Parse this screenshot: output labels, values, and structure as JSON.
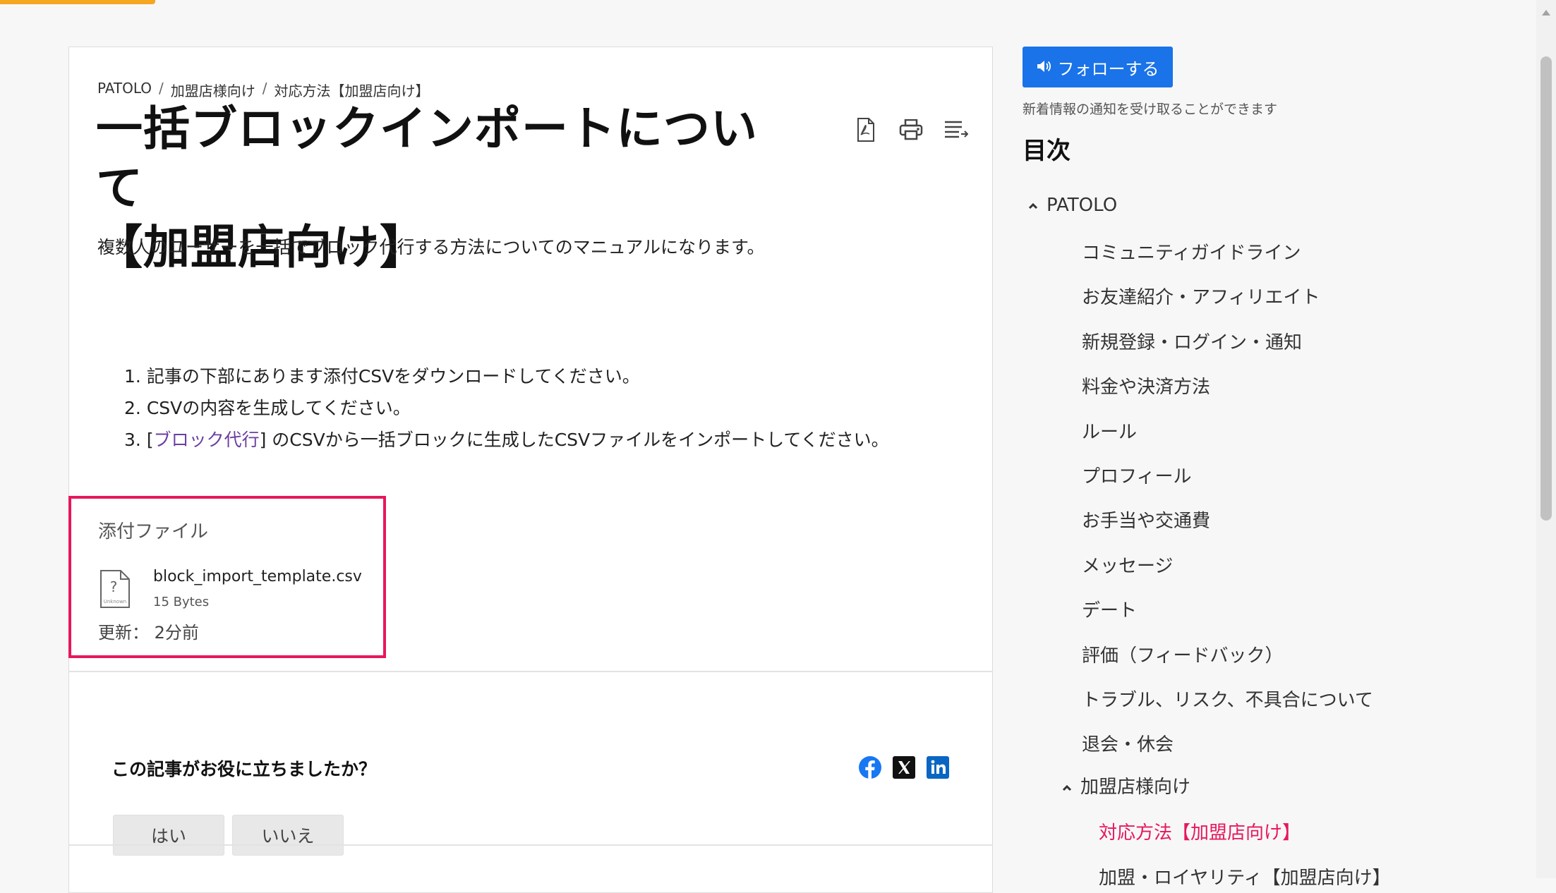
{
  "breadcrumb": [
    "PATOLO",
    "加盟店様向け",
    "対応方法【加盟店向け】"
  ],
  "breadcrumb_sep": "/",
  "article": {
    "title_line1": "一括ブロックインポートについて",
    "title_line2": "【加盟店向け】",
    "intro": "複数人のユーザーを一括でブロック代行する方法についてのマニュアルになります。",
    "steps": [
      {
        "num": "1.",
        "text": "記事の下部にあります添付CSVをダウンロードしてください。"
      },
      {
        "num": "2.",
        "text": "CSVの内容を生成してください。"
      },
      {
        "num": "3.",
        "pre": "[",
        "link": "ブロック代行",
        "post": "] のCSVから一括ブロックに生成したCSVファイルをインポートしてください。"
      }
    ],
    "tools": [
      "pdf-icon",
      "print-icon",
      "subscribe-icon"
    ]
  },
  "attachment": {
    "label": "添付ファイル",
    "file_name": "block_import_template.csv",
    "file_size": "15 Bytes",
    "icon_text": "Unknown",
    "updated_label": "更新：",
    "updated_value": "2分前"
  },
  "feedback": {
    "question": "この記事がお役に立ちましたか？",
    "yes": "はい",
    "no": "いいえ",
    "social": [
      "facebook-icon",
      "x-icon",
      "linkedin-icon"
    ]
  },
  "sidebar": {
    "follow_label": "フォローする",
    "follow_note": "新着情報の通知を受け取ることができます",
    "toc_title": "目次",
    "toc_root": "PATOLO",
    "toc_items": [
      "コミュニティガイドライン",
      "お友達紹介・アフィリエイト",
      "新規登録・ログイン・通知",
      "料金や決済方法",
      "ルール",
      "プロフィール",
      "お手当や交通費",
      "メッセージ",
      "デート",
      "評価（フィードバック）",
      "トラブル、リスク、不具合について",
      "退会・休会"
    ],
    "toc_sub_group": "加盟店様向け",
    "toc_sub_items": [
      "対応方法【加盟店向け】",
      "加盟・ロイヤリティ【加盟店向け】"
    ]
  },
  "colors": {
    "accent": "#1a73e8",
    "active_link": "#e6185c",
    "highlight_box": "#e6185c",
    "progress": "#f5a623"
  }
}
